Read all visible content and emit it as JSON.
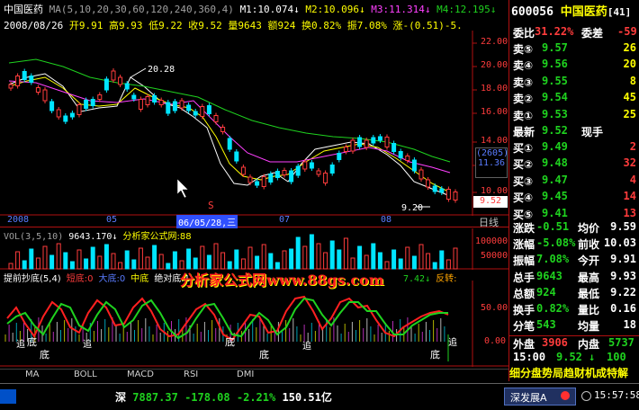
{
  "header": {
    "stock_name": "中国医药",
    "ma_params": "MA(5,10,20,30,60,120,240,360,4)",
    "m1": "M1:10.074",
    "m2": "M2:10.096",
    "m3": "M3:11.314",
    "m4": "M4:12.195",
    "arrow": "↓",
    "row2": {
      "date": "2008/08/26",
      "open": "开9.91",
      "high": "高9.93",
      "low": "低9.22",
      "close": "收9.52",
      "volume": "量9643",
      "amount": "额924",
      "turnover": "换0.82%",
      "amplitude": "振7.08%",
      "change": "涨-(0.51)-5."
    }
  },
  "price_axis": [
    "22.00",
    "20.00",
    "18.00",
    "16.00",
    "14.00",
    "12.00",
    "10.00"
  ],
  "price_labels": {
    "high_mark": "20.28",
    "low_mark": "9.20",
    "current": "9.52",
    "box_top": "(2605)",
    "box_bottom": "11.36",
    "s_mark": "S"
  },
  "date_axis": {
    "labels": [
      "2008",
      "05",
      "06/05/28,三",
      "07",
      "08"
    ],
    "period": "日线"
  },
  "volume_panel": {
    "title": "VOL(3,5,10)",
    "value": "9643.170",
    "arrow": "↓",
    "source": "分析家公式网:88",
    "axis": [
      "100000",
      "50000"
    ]
  },
  "indicator_panel": {
    "title": "提前抄底(5,4)",
    "short_bottom": "短底:0",
    "big_bottom": "大底:0",
    "mid_bottom": "中底",
    "abs_bottom": "绝对底:1",
    "end_value": "7.42↓",
    "turn": "反转:",
    "watermark": "分析家公式网www.88gs.com",
    "axis": [
      "50.00",
      "0.00"
    ],
    "bottom_labels": [
      "底",
      "底",
      "底",
      "底",
      "底"
    ],
    "chao_labels": [
      "追",
      "追",
      "追",
      "追"
    ]
  },
  "tabs": [
    "MA",
    "BOLL",
    "MACD",
    "RSI",
    "DMI"
  ],
  "quote": {
    "code": "600056",
    "name": "中国医药",
    "page": "[41]",
    "wei_bi_label": "委比",
    "wei_bi": "31.22%",
    "wei_cha_label": "委差",
    "wei_cha": "-59",
    "sells": [
      {
        "label": "卖⑤",
        "price": "9.57",
        "vol": "26"
      },
      {
        "label": "卖④",
        "price": "9.56",
        "vol": "20"
      },
      {
        "label": "卖③",
        "price": "9.55",
        "vol": "8"
      },
      {
        "label": "卖②",
        "price": "9.54",
        "vol": "45"
      },
      {
        "label": "卖①",
        "price": "9.53",
        "vol": "25"
      }
    ],
    "latest_label": "最新",
    "latest": "9.52",
    "spot_label": "现手",
    "buys": [
      {
        "label": "买①",
        "price": "9.49",
        "vol": "2"
      },
      {
        "label": "买②",
        "price": "9.48",
        "vol": "32"
      },
      {
        "label": "买③",
        "price": "9.47",
        "vol": "4"
      },
      {
        "label": "买④",
        "price": "9.45",
        "vol": "14"
      },
      {
        "label": "买⑤",
        "price": "9.41",
        "vol": "13"
      }
    ],
    "stats": [
      {
        "l1": "涨跌",
        "v1": "-0.51",
        "l2": "均价",
        "v2": "9.59"
      },
      {
        "l1": "涨幅",
        "v1": "-5.08%",
        "l2": "前收",
        "v2": "10.03"
      },
      {
        "l1": "振幅",
        "v1": "7.08%",
        "l2": "今开",
        "v2": "9.91"
      },
      {
        "l1": "总手",
        "v1": "9643",
        "l2": "最高",
        "v2": "9.93"
      },
      {
        "l1": "总额",
        "v1": "924",
        "l2": "最低",
        "v2": "9.22"
      },
      {
        "l1": "换手",
        "v1": "0.82%",
        "l2": "量比",
        "v2": "0.16"
      },
      {
        "l1": "分笔",
        "v1": "543",
        "l2": "均量",
        "v2": "18"
      }
    ],
    "outer_label": "外盘",
    "outer": "3906",
    "inner_label": "内盘",
    "inner": "5737",
    "tick_time": "15:00",
    "tick_price": "9.52",
    "tick_vol": "100",
    "bottom_banner": "细分盘势局趋财机成特解"
  },
  "status_bar": {
    "market": "深",
    "index": "7887.37",
    "change": "-178.08",
    "pct": "-2.21%",
    "amount": "150.51亿",
    "exchange": "深发展A",
    "time": "15:57:58"
  },
  "colors": {
    "up": "#ff3c3c",
    "down": "#1fd21f",
    "axis": "#b01010",
    "price_label": "#ffff00"
  }
}
